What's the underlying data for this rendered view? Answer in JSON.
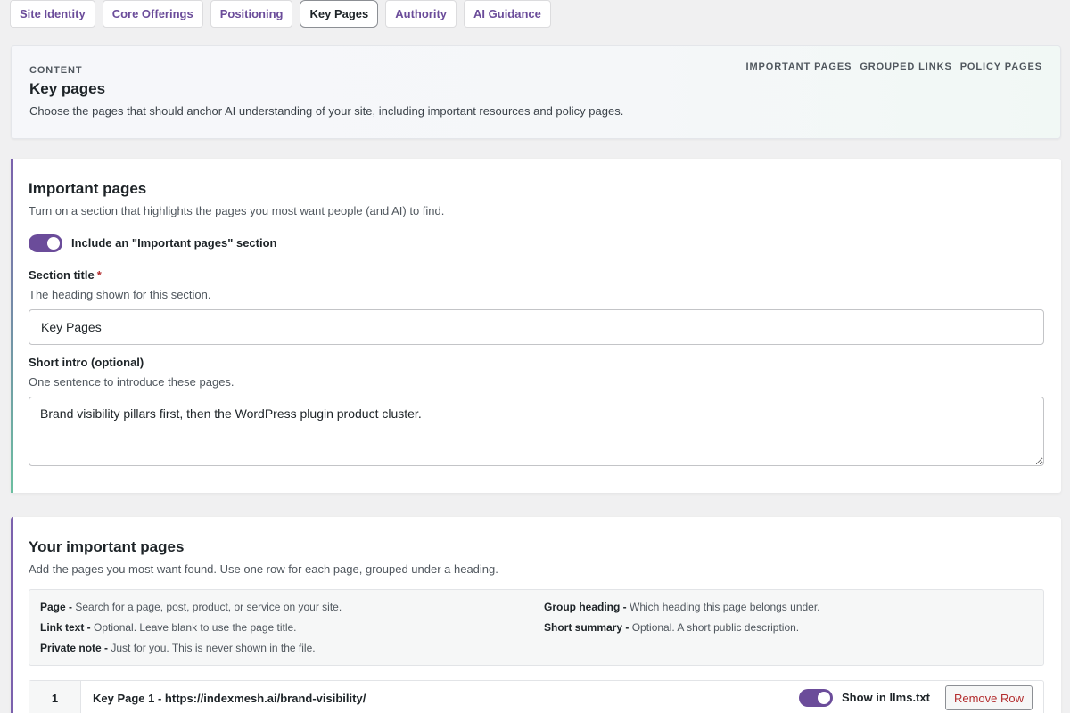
{
  "tabs": [
    {
      "label": "Site Identity"
    },
    {
      "label": "Core Offerings"
    },
    {
      "label": "Positioning"
    },
    {
      "label": "Key Pages",
      "active": true
    },
    {
      "label": "Authority"
    },
    {
      "label": "AI Guidance"
    }
  ],
  "header": {
    "eyebrow": "CONTENT",
    "title": "Key pages",
    "description": "Choose the pages that should anchor AI understanding of your site, including important resources and policy pages.",
    "links": [
      "IMPORTANT PAGES",
      "GROUPED LINKS",
      "POLICY PAGES"
    ]
  },
  "important": {
    "title": "Important pages",
    "subtitle": "Turn on a section that highlights the pages you most want people (and AI) to find.",
    "toggle_label": "Include an \"Important pages\" section",
    "toggle_on": true,
    "section_title_label": "Section title",
    "section_title_required": "*",
    "section_title_help": "The heading shown for this section.",
    "section_title_value": "Key Pages",
    "intro_label": "Short intro (optional)",
    "intro_help": "One sentence to introduce these pages.",
    "intro_value": "Brand visibility pillars first, then the WordPress plugin product cluster."
  },
  "your_pages": {
    "title": "Your important pages",
    "subtitle": "Add the pages you most want found. Use one row for each page, grouped under a heading.",
    "help": {
      "page_term": "Page -",
      "page_desc": "Search for a page, post, product, or service on your site.",
      "link_term": "Link text -",
      "link_desc": "Optional. Leave blank to use the page title.",
      "note_term": "Private note -",
      "note_desc": "Just for you. This is never shown in the file.",
      "group_term": "Group heading -",
      "group_desc": "Which heading this page belongs under.",
      "summary_term": "Short summary -",
      "summary_desc": "Optional. A short public description."
    },
    "rows": [
      {
        "number": "1",
        "title": "Key Page 1 - https://indexmesh.ai/brand-visibility/",
        "show_label": "Show in llms.txt",
        "show_on": true,
        "remove_label": "Remove Row"
      }
    ]
  },
  "colors": {
    "accent": "#6b4c9a",
    "danger": "#b32d2e",
    "accent_green": "#6bbfa0"
  }
}
